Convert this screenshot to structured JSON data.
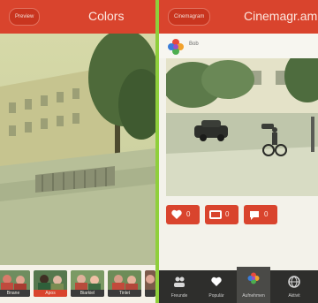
{
  "left": {
    "back_label": "Preview",
    "title": "Colors",
    "filters": [
      {
        "label": "Bnane",
        "selected": false
      },
      {
        "label": "Apos",
        "selected": true
      },
      {
        "label": "Biarkiel",
        "selected": false
      },
      {
        "label": "Tinlet",
        "selected": false
      },
      {
        "label": "",
        "selected": false
      }
    ]
  },
  "right": {
    "back_label": "Cinemagram",
    "title": "Cinemagr.am",
    "user": {
      "name": "Bob"
    },
    "actions": {
      "likes": "0",
      "reposts": "0",
      "comments": "0"
    },
    "tabs": [
      {
        "label": "Freunde",
        "icon": "people-icon"
      },
      {
        "label": "Populär",
        "icon": "heart-icon"
      },
      {
        "label": "Aufnehmen",
        "icon": "flower-icon"
      },
      {
        "label": "Aktivit",
        "icon": "globe-icon"
      }
    ]
  },
  "colors": {
    "accent": "#d9442d",
    "divider": "#8fcf3c",
    "tabbar": "#2e2e2c"
  }
}
